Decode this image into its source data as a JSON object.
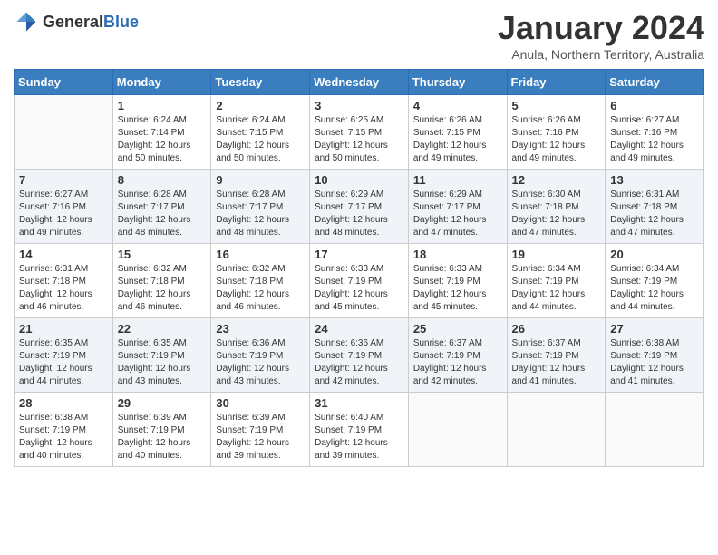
{
  "header": {
    "logo_general": "General",
    "logo_blue": "Blue",
    "month_title": "January 2024",
    "location": "Anula, Northern Territory, Australia"
  },
  "days_of_week": [
    "Sunday",
    "Monday",
    "Tuesday",
    "Wednesday",
    "Thursday",
    "Friday",
    "Saturday"
  ],
  "weeks": [
    [
      {
        "day": "",
        "sunrise": "",
        "sunset": "",
        "daylight": ""
      },
      {
        "day": "1",
        "sunrise": "Sunrise: 6:24 AM",
        "sunset": "Sunset: 7:14 PM",
        "daylight": "Daylight: 12 hours and 50 minutes."
      },
      {
        "day": "2",
        "sunrise": "Sunrise: 6:24 AM",
        "sunset": "Sunset: 7:15 PM",
        "daylight": "Daylight: 12 hours and 50 minutes."
      },
      {
        "day": "3",
        "sunrise": "Sunrise: 6:25 AM",
        "sunset": "Sunset: 7:15 PM",
        "daylight": "Daylight: 12 hours and 50 minutes."
      },
      {
        "day": "4",
        "sunrise": "Sunrise: 6:26 AM",
        "sunset": "Sunset: 7:15 PM",
        "daylight": "Daylight: 12 hours and 49 minutes."
      },
      {
        "day": "5",
        "sunrise": "Sunrise: 6:26 AM",
        "sunset": "Sunset: 7:16 PM",
        "daylight": "Daylight: 12 hours and 49 minutes."
      },
      {
        "day": "6",
        "sunrise": "Sunrise: 6:27 AM",
        "sunset": "Sunset: 7:16 PM",
        "daylight": "Daylight: 12 hours and 49 minutes."
      }
    ],
    [
      {
        "day": "7",
        "sunrise": "Sunrise: 6:27 AM",
        "sunset": "Sunset: 7:16 PM",
        "daylight": "Daylight: 12 hours and 49 minutes."
      },
      {
        "day": "8",
        "sunrise": "Sunrise: 6:28 AM",
        "sunset": "Sunset: 7:17 PM",
        "daylight": "Daylight: 12 hours and 48 minutes."
      },
      {
        "day": "9",
        "sunrise": "Sunrise: 6:28 AM",
        "sunset": "Sunset: 7:17 PM",
        "daylight": "Daylight: 12 hours and 48 minutes."
      },
      {
        "day": "10",
        "sunrise": "Sunrise: 6:29 AM",
        "sunset": "Sunset: 7:17 PM",
        "daylight": "Daylight: 12 hours and 48 minutes."
      },
      {
        "day": "11",
        "sunrise": "Sunrise: 6:29 AM",
        "sunset": "Sunset: 7:17 PM",
        "daylight": "Daylight: 12 hours and 47 minutes."
      },
      {
        "day": "12",
        "sunrise": "Sunrise: 6:30 AM",
        "sunset": "Sunset: 7:18 PM",
        "daylight": "Daylight: 12 hours and 47 minutes."
      },
      {
        "day": "13",
        "sunrise": "Sunrise: 6:31 AM",
        "sunset": "Sunset: 7:18 PM",
        "daylight": "Daylight: 12 hours and 47 minutes."
      }
    ],
    [
      {
        "day": "14",
        "sunrise": "Sunrise: 6:31 AM",
        "sunset": "Sunset: 7:18 PM",
        "daylight": "Daylight: 12 hours and 46 minutes."
      },
      {
        "day": "15",
        "sunrise": "Sunrise: 6:32 AM",
        "sunset": "Sunset: 7:18 PM",
        "daylight": "Daylight: 12 hours and 46 minutes."
      },
      {
        "day": "16",
        "sunrise": "Sunrise: 6:32 AM",
        "sunset": "Sunset: 7:18 PM",
        "daylight": "Daylight: 12 hours and 46 minutes."
      },
      {
        "day": "17",
        "sunrise": "Sunrise: 6:33 AM",
        "sunset": "Sunset: 7:19 PM",
        "daylight": "Daylight: 12 hours and 45 minutes."
      },
      {
        "day": "18",
        "sunrise": "Sunrise: 6:33 AM",
        "sunset": "Sunset: 7:19 PM",
        "daylight": "Daylight: 12 hours and 45 minutes."
      },
      {
        "day": "19",
        "sunrise": "Sunrise: 6:34 AM",
        "sunset": "Sunset: 7:19 PM",
        "daylight": "Daylight: 12 hours and 44 minutes."
      },
      {
        "day": "20",
        "sunrise": "Sunrise: 6:34 AM",
        "sunset": "Sunset: 7:19 PM",
        "daylight": "Daylight: 12 hours and 44 minutes."
      }
    ],
    [
      {
        "day": "21",
        "sunrise": "Sunrise: 6:35 AM",
        "sunset": "Sunset: 7:19 PM",
        "daylight": "Daylight: 12 hours and 44 minutes."
      },
      {
        "day": "22",
        "sunrise": "Sunrise: 6:35 AM",
        "sunset": "Sunset: 7:19 PM",
        "daylight": "Daylight: 12 hours and 43 minutes."
      },
      {
        "day": "23",
        "sunrise": "Sunrise: 6:36 AM",
        "sunset": "Sunset: 7:19 PM",
        "daylight": "Daylight: 12 hours and 43 minutes."
      },
      {
        "day": "24",
        "sunrise": "Sunrise: 6:36 AM",
        "sunset": "Sunset: 7:19 PM",
        "daylight": "Daylight: 12 hours and 42 minutes."
      },
      {
        "day": "25",
        "sunrise": "Sunrise: 6:37 AM",
        "sunset": "Sunset: 7:19 PM",
        "daylight": "Daylight: 12 hours and 42 minutes."
      },
      {
        "day": "26",
        "sunrise": "Sunrise: 6:37 AM",
        "sunset": "Sunset: 7:19 PM",
        "daylight": "Daylight: 12 hours and 41 minutes."
      },
      {
        "day": "27",
        "sunrise": "Sunrise: 6:38 AM",
        "sunset": "Sunset: 7:19 PM",
        "daylight": "Daylight: 12 hours and 41 minutes."
      }
    ],
    [
      {
        "day": "28",
        "sunrise": "Sunrise: 6:38 AM",
        "sunset": "Sunset: 7:19 PM",
        "daylight": "Daylight: 12 hours and 40 minutes."
      },
      {
        "day": "29",
        "sunrise": "Sunrise: 6:39 AM",
        "sunset": "Sunset: 7:19 PM",
        "daylight": "Daylight: 12 hours and 40 minutes."
      },
      {
        "day": "30",
        "sunrise": "Sunrise: 6:39 AM",
        "sunset": "Sunset: 7:19 PM",
        "daylight": "Daylight: 12 hours and 39 minutes."
      },
      {
        "day": "31",
        "sunrise": "Sunrise: 6:40 AM",
        "sunset": "Sunset: 7:19 PM",
        "daylight": "Daylight: 12 hours and 39 minutes."
      },
      {
        "day": "",
        "sunrise": "",
        "sunset": "",
        "daylight": ""
      },
      {
        "day": "",
        "sunrise": "",
        "sunset": "",
        "daylight": ""
      },
      {
        "day": "",
        "sunrise": "",
        "sunset": "",
        "daylight": ""
      }
    ]
  ]
}
